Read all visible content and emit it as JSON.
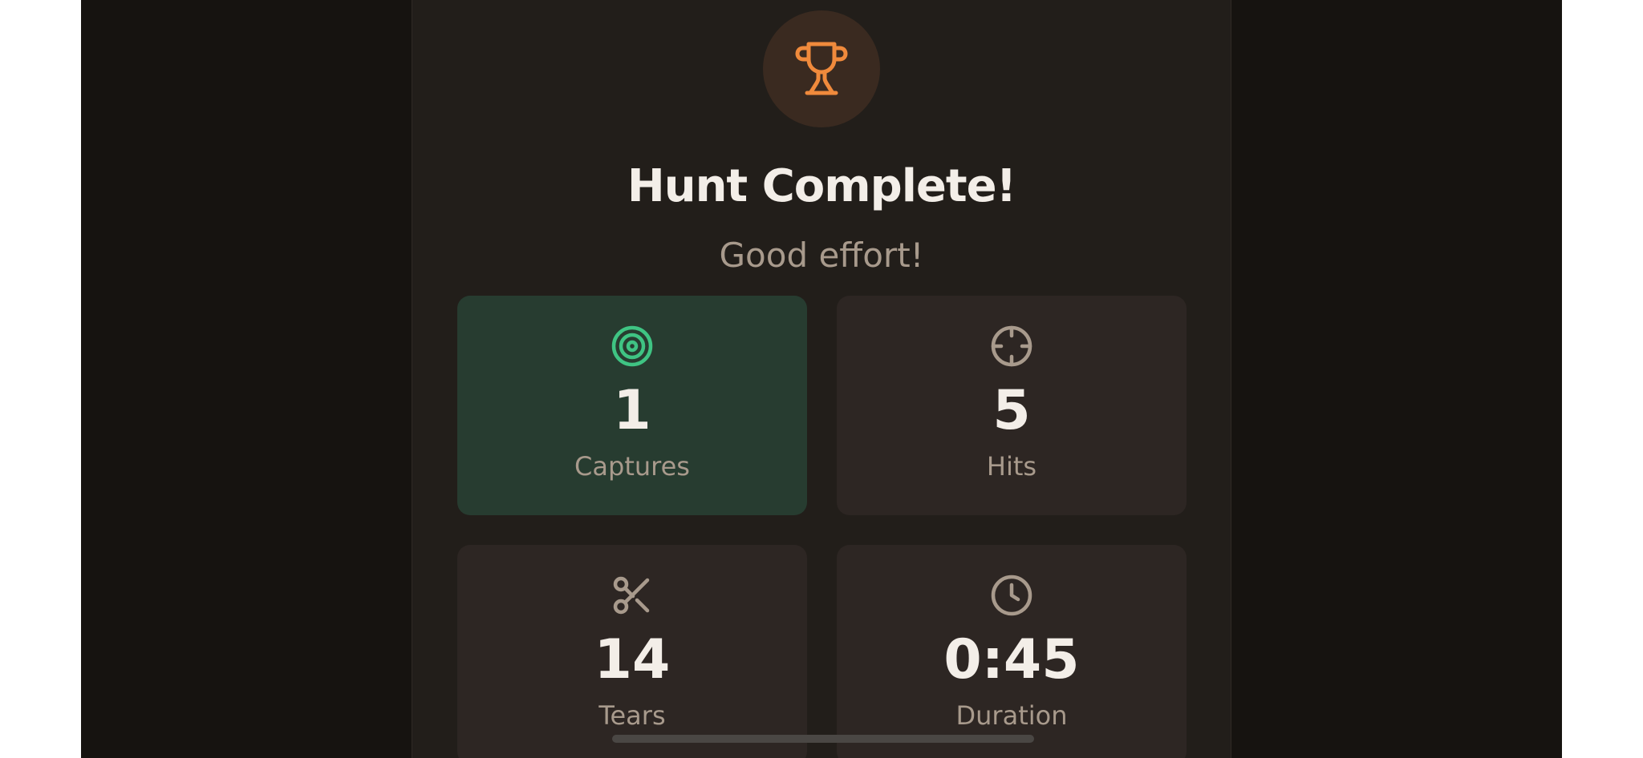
{
  "colors": {
    "accent": "#f08a3c",
    "success": "#3fc483",
    "muted_icon": "#a89a8c",
    "background": "#221e1a"
  },
  "header": {
    "icon": "trophy-icon",
    "title": "Hunt Complete!",
    "subtitle": "Good effort!"
  },
  "stats": [
    {
      "icon": "target-icon",
      "value": "1",
      "label": "Captures"
    },
    {
      "icon": "crosshair-icon",
      "value": "5",
      "label": "Hits"
    },
    {
      "icon": "scissors-icon",
      "value": "14",
      "label": "Tears"
    },
    {
      "icon": "clock-icon",
      "value": "0:45",
      "label": "Duration"
    }
  ]
}
